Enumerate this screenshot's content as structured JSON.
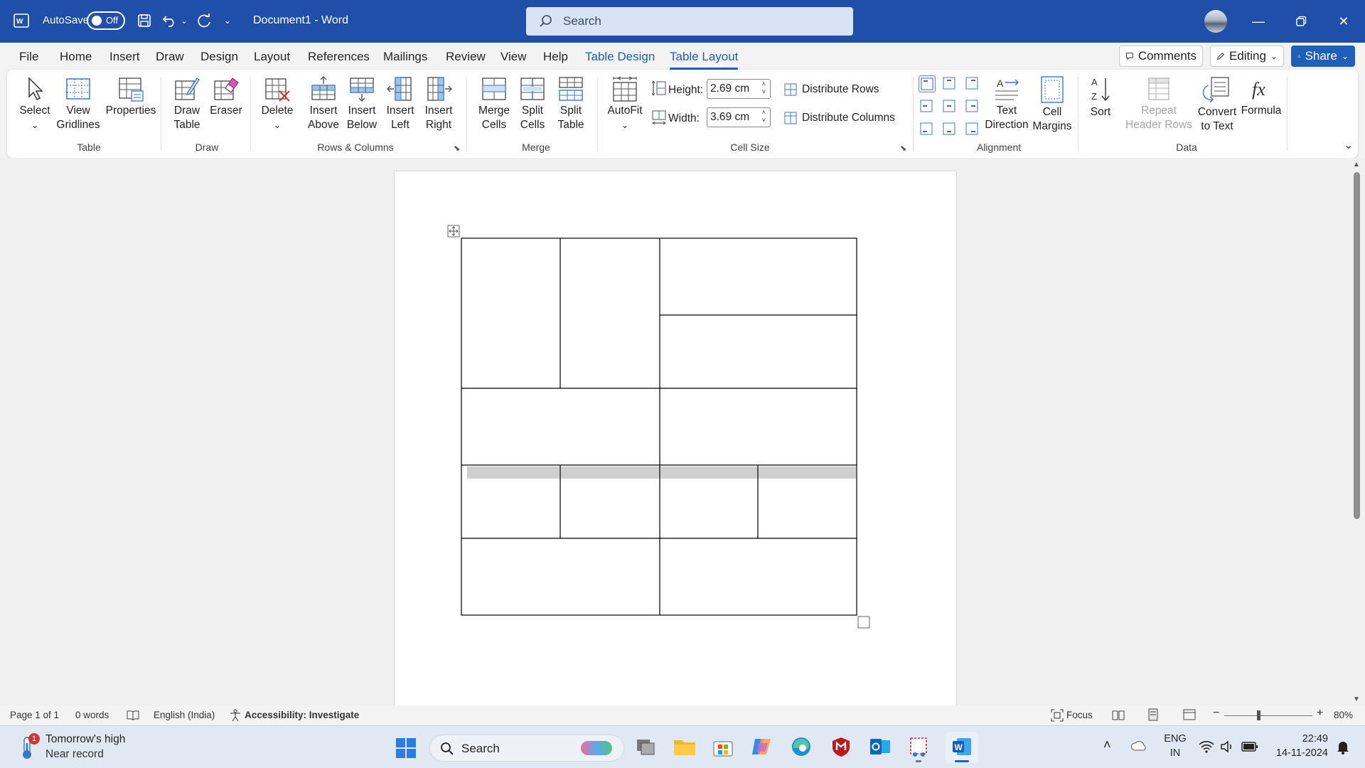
{
  "titlebar": {
    "autosave_label": "AutoSave",
    "autosave_state": "Off",
    "doc_title": "Document1  -  Word",
    "search_placeholder": "Search",
    "accent": "#1f4fa8"
  },
  "menu": {
    "tabs": [
      "File",
      "Home",
      "Insert",
      "Draw",
      "Design",
      "Layout",
      "References",
      "Mailings",
      "Review",
      "View",
      "Help",
      "Table Design",
      "Table Layout"
    ],
    "active": "Table Layout",
    "comments": "Comments",
    "editing": "Editing",
    "share": "Share"
  },
  "ribbon": {
    "table": {
      "select": "Select",
      "view_gridlines_1": "View",
      "view_gridlines_2": "Gridlines",
      "properties": "Properties",
      "group": "Table"
    },
    "draw": {
      "draw_table_1": "Draw",
      "draw_table_2": "Table",
      "eraser": "Eraser",
      "group": "Draw"
    },
    "rows_columns": {
      "delete": "Delete",
      "insert_above_1": "Insert",
      "insert_above_2": "Above",
      "insert_below_1": "Insert",
      "insert_below_2": "Below",
      "insert_left_1": "Insert",
      "insert_left_2": "Left",
      "insert_right_1": "Insert",
      "insert_right_2": "Right",
      "group": "Rows & Columns"
    },
    "merge": {
      "merge_cells_1": "Merge",
      "merge_cells_2": "Cells",
      "split_cells_1": "Split",
      "split_cells_2": "Cells",
      "split_table_1": "Split",
      "split_table_2": "Table",
      "group": "Merge"
    },
    "cell_size": {
      "autofit": "AutoFit",
      "height_label": "Height:",
      "height_value": "2.69 cm",
      "width_label": "Width:",
      "width_value": "3.69 cm",
      "distribute_rows": "Distribute Rows",
      "distribute_columns": "Distribute Columns",
      "group": "Cell Size"
    },
    "alignment": {
      "text_direction_1": "Text",
      "text_direction_2": "Direction",
      "cell_margins_1": "Cell",
      "cell_margins_2": "Margins",
      "group": "Alignment"
    },
    "data": {
      "sort": "Sort",
      "repeat_header_1": "Repeat",
      "repeat_header_2": "Header Rows",
      "convert_1": "Convert",
      "convert_2": "to Text",
      "formula": "Formula",
      "group": "Data"
    }
  },
  "statusbar": {
    "page": "Page 1 of 1",
    "words": "0 words",
    "language": "English (India)",
    "accessibility": "Accessibility: Investigate",
    "focus": "Focus",
    "zoom": "80%"
  },
  "taskbar": {
    "weather_title": "Tomorrow's high",
    "weather_sub": "Near record",
    "weather_badge": "1",
    "search": "Search",
    "lang_1": "ENG",
    "lang_2": "IN",
    "time": "22:49",
    "date": "14-11-2024"
  }
}
